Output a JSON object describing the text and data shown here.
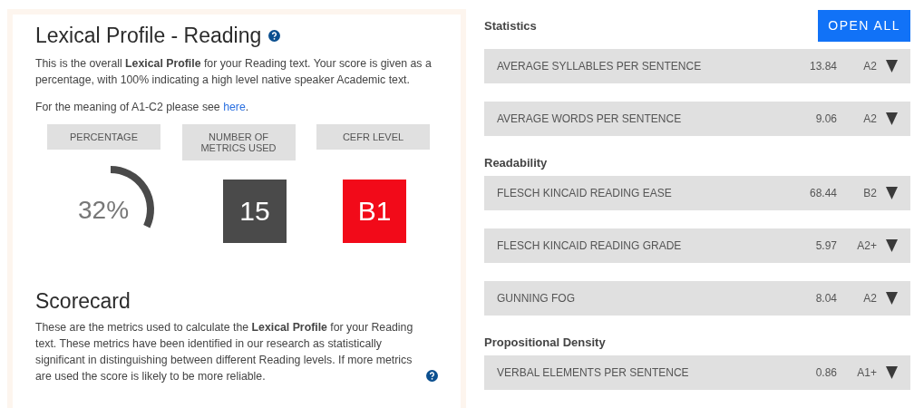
{
  "profile": {
    "title": "Lexical Profile - Reading",
    "intro": "This is the overall **Lexical Profile** for your Reading text. Your score is given as a percentage, with 100% indicating a high level native speaker Academic text.",
    "meaning_text": "For the meaning of A1-C2 please see ",
    "meaning_link": "here",
    "meaning_end": ".",
    "headers": [
      "PERCENTAGE",
      "NUMBER OF METRICS USED",
      "CEFR LEVEL"
    ],
    "percentage": {
      "reading": "32%"
    },
    "metrics_used": "15",
    "cefr": {
      "label": "B1",
      "color": "#f20a19"
    }
  },
  "scorecard": {
    "title": "Scorecard",
    "text": "These are the metrics used to calculate the **Lexical Profile** for your Reading text. These metrics have been identified in our research as statistically significant in distinguishing between different Reading levels. If more metrics are used the score is likely to be more reliable."
  },
  "open_all": "OPEN ALL",
  "sections": [
    {
      "title": "Statistics",
      "metrics": [
        {
          "name": "AVERAGE SYLLABLES PER SENTENCE",
          "value": "13.84",
          "level": "A2"
        },
        {
          "name": "AVERAGE WORDS PER SENTENCE",
          "value": "9.06",
          "level": "A2"
        }
      ]
    },
    {
      "title": "Readability",
      "metrics": [
        {
          "name": "FLESCH KINCAID READING EASE",
          "value": "68.44",
          "level": "B2"
        },
        {
          "name": "FLESCH KINCAID READING GRADE",
          "value": "5.97",
          "level": "A2+"
        },
        {
          "name": "GUNNING FOG",
          "value": "8.04",
          "level": "A2"
        }
      ]
    },
    {
      "title": "Propositional Density",
      "metrics": [
        {
          "name": "VERBAL ELEMENTS PER SENTENCE",
          "value": "0.86",
          "level": "A1+"
        }
      ]
    }
  ]
}
